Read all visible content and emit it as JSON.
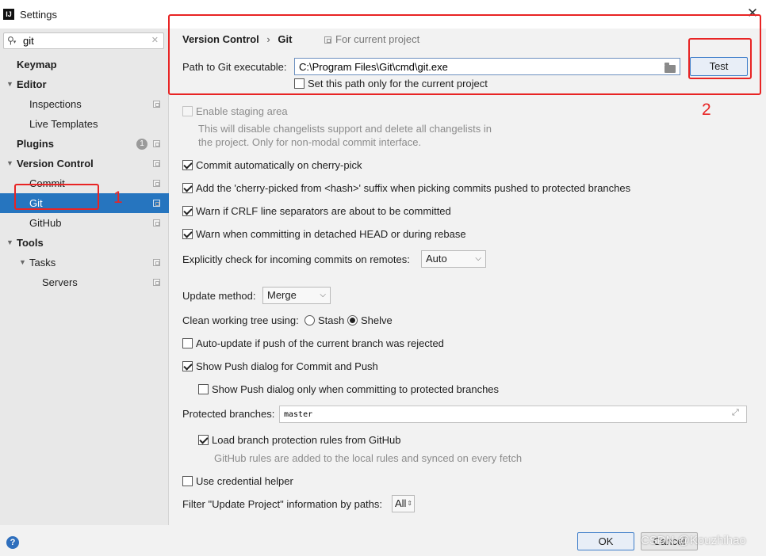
{
  "window": {
    "title": "Settings",
    "logo": "IJ",
    "close_glyph": "✕"
  },
  "sidebar": {
    "search_value": "git",
    "search_clear": "✕",
    "items": [
      {
        "label": "Keymap"
      },
      {
        "label": "Editor"
      },
      {
        "label": "Inspections"
      },
      {
        "label": "Live Templates"
      },
      {
        "label": "Plugins",
        "badge": "1"
      },
      {
        "label": "Version Control"
      },
      {
        "label": "Commit"
      },
      {
        "label": "Git"
      },
      {
        "label": "GitHub"
      },
      {
        "label": "Tools"
      },
      {
        "label": "Tasks"
      },
      {
        "label": "Servers"
      }
    ]
  },
  "header": {
    "breadcrumb_parent": "Version Control",
    "breadcrumb_sep": "›",
    "breadcrumb_current": "Git",
    "scope_label": "For current project"
  },
  "git_path": {
    "label": "Path to Git executable:",
    "value": "C:\\Program Files\\Git\\cmd\\git.exe",
    "test_button": "Test",
    "project_only_label": "Set this path only for the current project"
  },
  "options": {
    "staging_area": "Enable staging area",
    "staging_hint_1": "This will disable changelists support and delete all changelists in",
    "staging_hint_2": "the project. Only for non-modal commit interface.",
    "commit_cherry_pick": "Commit automatically on cherry-pick",
    "cherry_picked_suffix": "Add the 'cherry-picked from <hash>' suffix when picking commits pushed to protected branches",
    "warn_crlf": "Warn if CRLF line separators are about to be committed",
    "warn_detached": "Warn when committing in detached HEAD or during rebase",
    "incoming_label": "Explicitly check for incoming commits on remotes:",
    "incoming_value": "Auto",
    "update_method_label": "Update method:",
    "update_method_value": "Merge",
    "clean_tree_label": "Clean working tree using:",
    "clean_stash": "Stash",
    "clean_shelve": "Shelve",
    "auto_update": "Auto-update if push of the current branch was rejected",
    "show_push_dialog": "Show Push dialog for Commit and Push",
    "show_push_protected": "Show Push dialog only when committing to protected branches",
    "protected_label": "Protected branches:",
    "protected_value": "master",
    "load_protection": "Load branch protection rules from GitHub",
    "load_protection_hint": "GitHub rules are added to the local rules and synced on every fetch",
    "credential_helper": "Use credential helper",
    "filter_label": "Filter \"Update Project\" information by paths:",
    "filter_value": "All"
  },
  "footer": {
    "ok": "OK",
    "cancel": "Cancel",
    "help": "?"
  },
  "annotations": {
    "num1": "1",
    "num2": "2",
    "watermark": "CSDN @Kouzhihao"
  },
  "colors": {
    "selection": "#2675bf",
    "annotation_red": "#e82424"
  }
}
